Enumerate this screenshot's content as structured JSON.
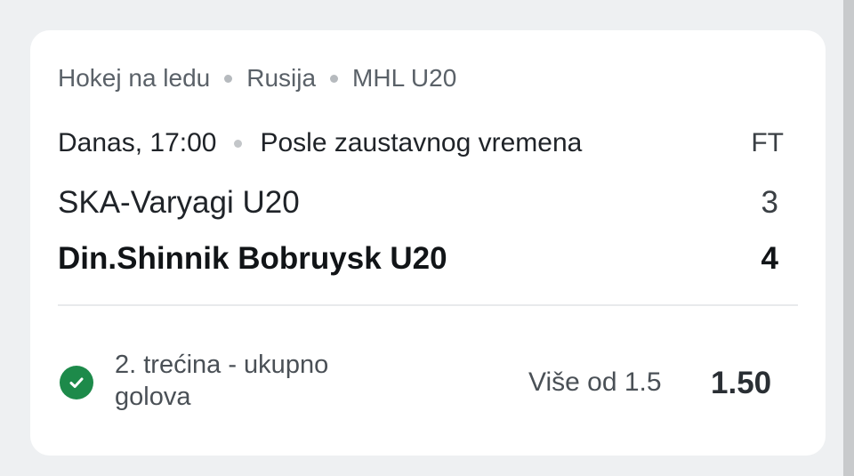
{
  "breadcrumb": {
    "sport": "Hokej na ledu",
    "country": "Rusija",
    "league": "MHL U20"
  },
  "match": {
    "time": "Danas, 17:00",
    "status_text": "Posle zaustavnog vremena",
    "status_code": "FT",
    "home_team": "SKA-Varyagi U20",
    "home_score": "3",
    "away_team": "Din.Shinnik Bobruysk U20",
    "away_score": "4"
  },
  "bet": {
    "icon": "check-circle-icon",
    "market": "2. trećina - ukupno golova",
    "selection": "Više od 1.5",
    "odds": "1.50",
    "status_color": "#1d8a4a"
  }
}
